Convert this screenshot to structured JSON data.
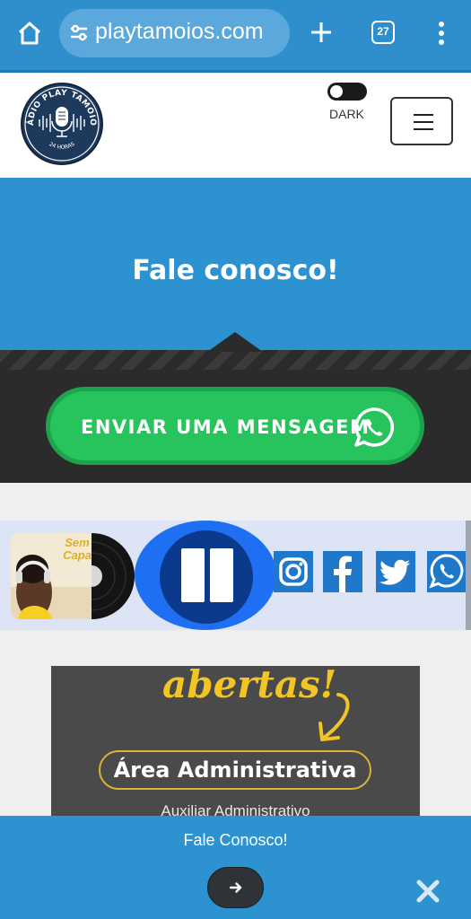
{
  "browser": {
    "url": "playtamoios.com",
    "tab_count": "27",
    "icons": [
      "home-icon",
      "tune-icon",
      "plus-icon",
      "tabs-icon",
      "more-vert-icon"
    ]
  },
  "header": {
    "logo_text_top": "RÁDIO PLAY TAMOIOS",
    "logo_text_bottom": "24 HORAS",
    "theme_toggle_label": "DARK"
  },
  "hero": {
    "title": "Fale conosco!"
  },
  "contact": {
    "whatsapp_button_label": "ENVIAR UMA MENSAGEM"
  },
  "player": {
    "cover_text": "Sem Capa",
    "state": "playing",
    "social": [
      "instagram-icon",
      "facebook-icon",
      "twitter-icon",
      "whatsapp-icon"
    ]
  },
  "ad": {
    "headline": "abertas!",
    "pill": "Área Administrativa",
    "subtitle": "Auxiliar Administrativo"
  },
  "bottom_bar": {
    "title": "Fale Conosco!"
  },
  "colors": {
    "chrome": "#2f8fcd",
    "hero": "#2d92d0",
    "whatsapp_green": "#27c35d",
    "player_bg": "#dce4f5",
    "play_blue": "#1f6ff2",
    "social_blue": "#1f78c9"
  }
}
